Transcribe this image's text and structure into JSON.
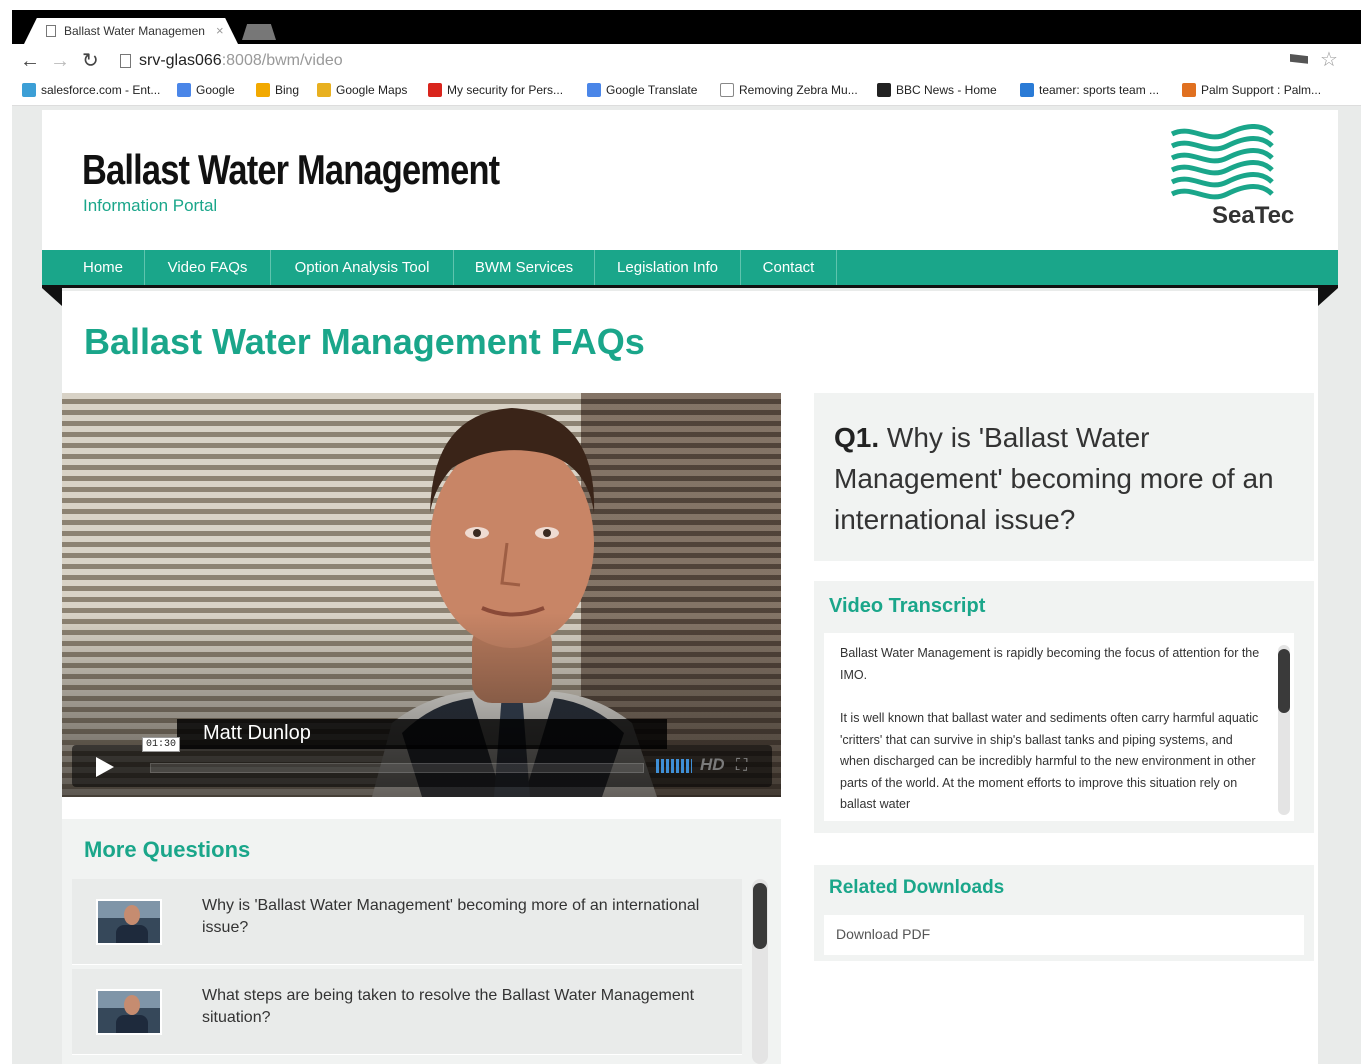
{
  "browser": {
    "tab_title": "Ballast Water Managemen",
    "tab_close": "×",
    "url_host": "srv-glas066",
    "url_rest": ":8008/bwm/video",
    "bookmarks": [
      {
        "label": "salesforce.com - Ent...",
        "icon": "cloud-icon",
        "color": "#3c9fd6"
      },
      {
        "label": "Google",
        "icon": "google-icon",
        "color": "#4a86e8"
      },
      {
        "label": "Bing",
        "icon": "bing-icon",
        "color": "#f2a900"
      },
      {
        "label": "Google Maps",
        "icon": "maps-icon",
        "color": "#e8b020"
      },
      {
        "label": "My security for Pers...",
        "icon": "security-icon",
        "color": "#d9251d"
      },
      {
        "label": "Google Translate",
        "icon": "translate-icon",
        "color": "#4a86e8"
      },
      {
        "label": "Removing Zebra Mu...",
        "icon": "page-icon",
        "color": "#ffffff"
      },
      {
        "label": "BBC News - Home",
        "icon": "bbc-icon",
        "color": "#222222"
      },
      {
        "label": "teamer: sports team ...",
        "icon": "teamer-icon",
        "color": "#2a7bd6"
      },
      {
        "label": "Palm Support : Palm...",
        "icon": "palm-icon",
        "color": "#e07020"
      }
    ]
  },
  "header": {
    "title": "Ballast Water Management",
    "subtitle": "Information Portal",
    "logo_text": "SeaTec",
    "accent": "#1aa68a"
  },
  "nav": {
    "items": [
      "Home",
      "Video FAQs",
      "Option Analysis Tool",
      "BWM Services",
      "Legislation Info",
      "Contact"
    ]
  },
  "main": {
    "page_title": "Ballast Water Management FAQs",
    "video": {
      "speaker": "Matt Dunlop",
      "time": "01:30",
      "hd": "HD"
    },
    "question": {
      "number": "Q1.",
      "text": "Why is 'Ballast Water Management' becoming more of an international issue?"
    },
    "transcript": {
      "heading": "Video Transcript",
      "paragraphs": [
        "Ballast Water Management is rapidly becoming the focus of attention for the IMO.",
        "It is well known that ballast water and sediments often carry harmful aquatic 'critters' that can survive in ship's ballast tanks and piping systems, and when discharged can be incredibly harmful to the new environment in other parts of the world. At the moment efforts to improve this situation rely on ballast water"
      ]
    },
    "downloads": {
      "heading": "Related Downloads",
      "items": [
        "Download PDF"
      ]
    },
    "more_questions": {
      "heading": "More Questions",
      "items": [
        "Why is 'Ballast Water Management' becoming more of an international issue?",
        "What steps are being taken to resolve the Ballast Water Management situation?"
      ]
    }
  }
}
